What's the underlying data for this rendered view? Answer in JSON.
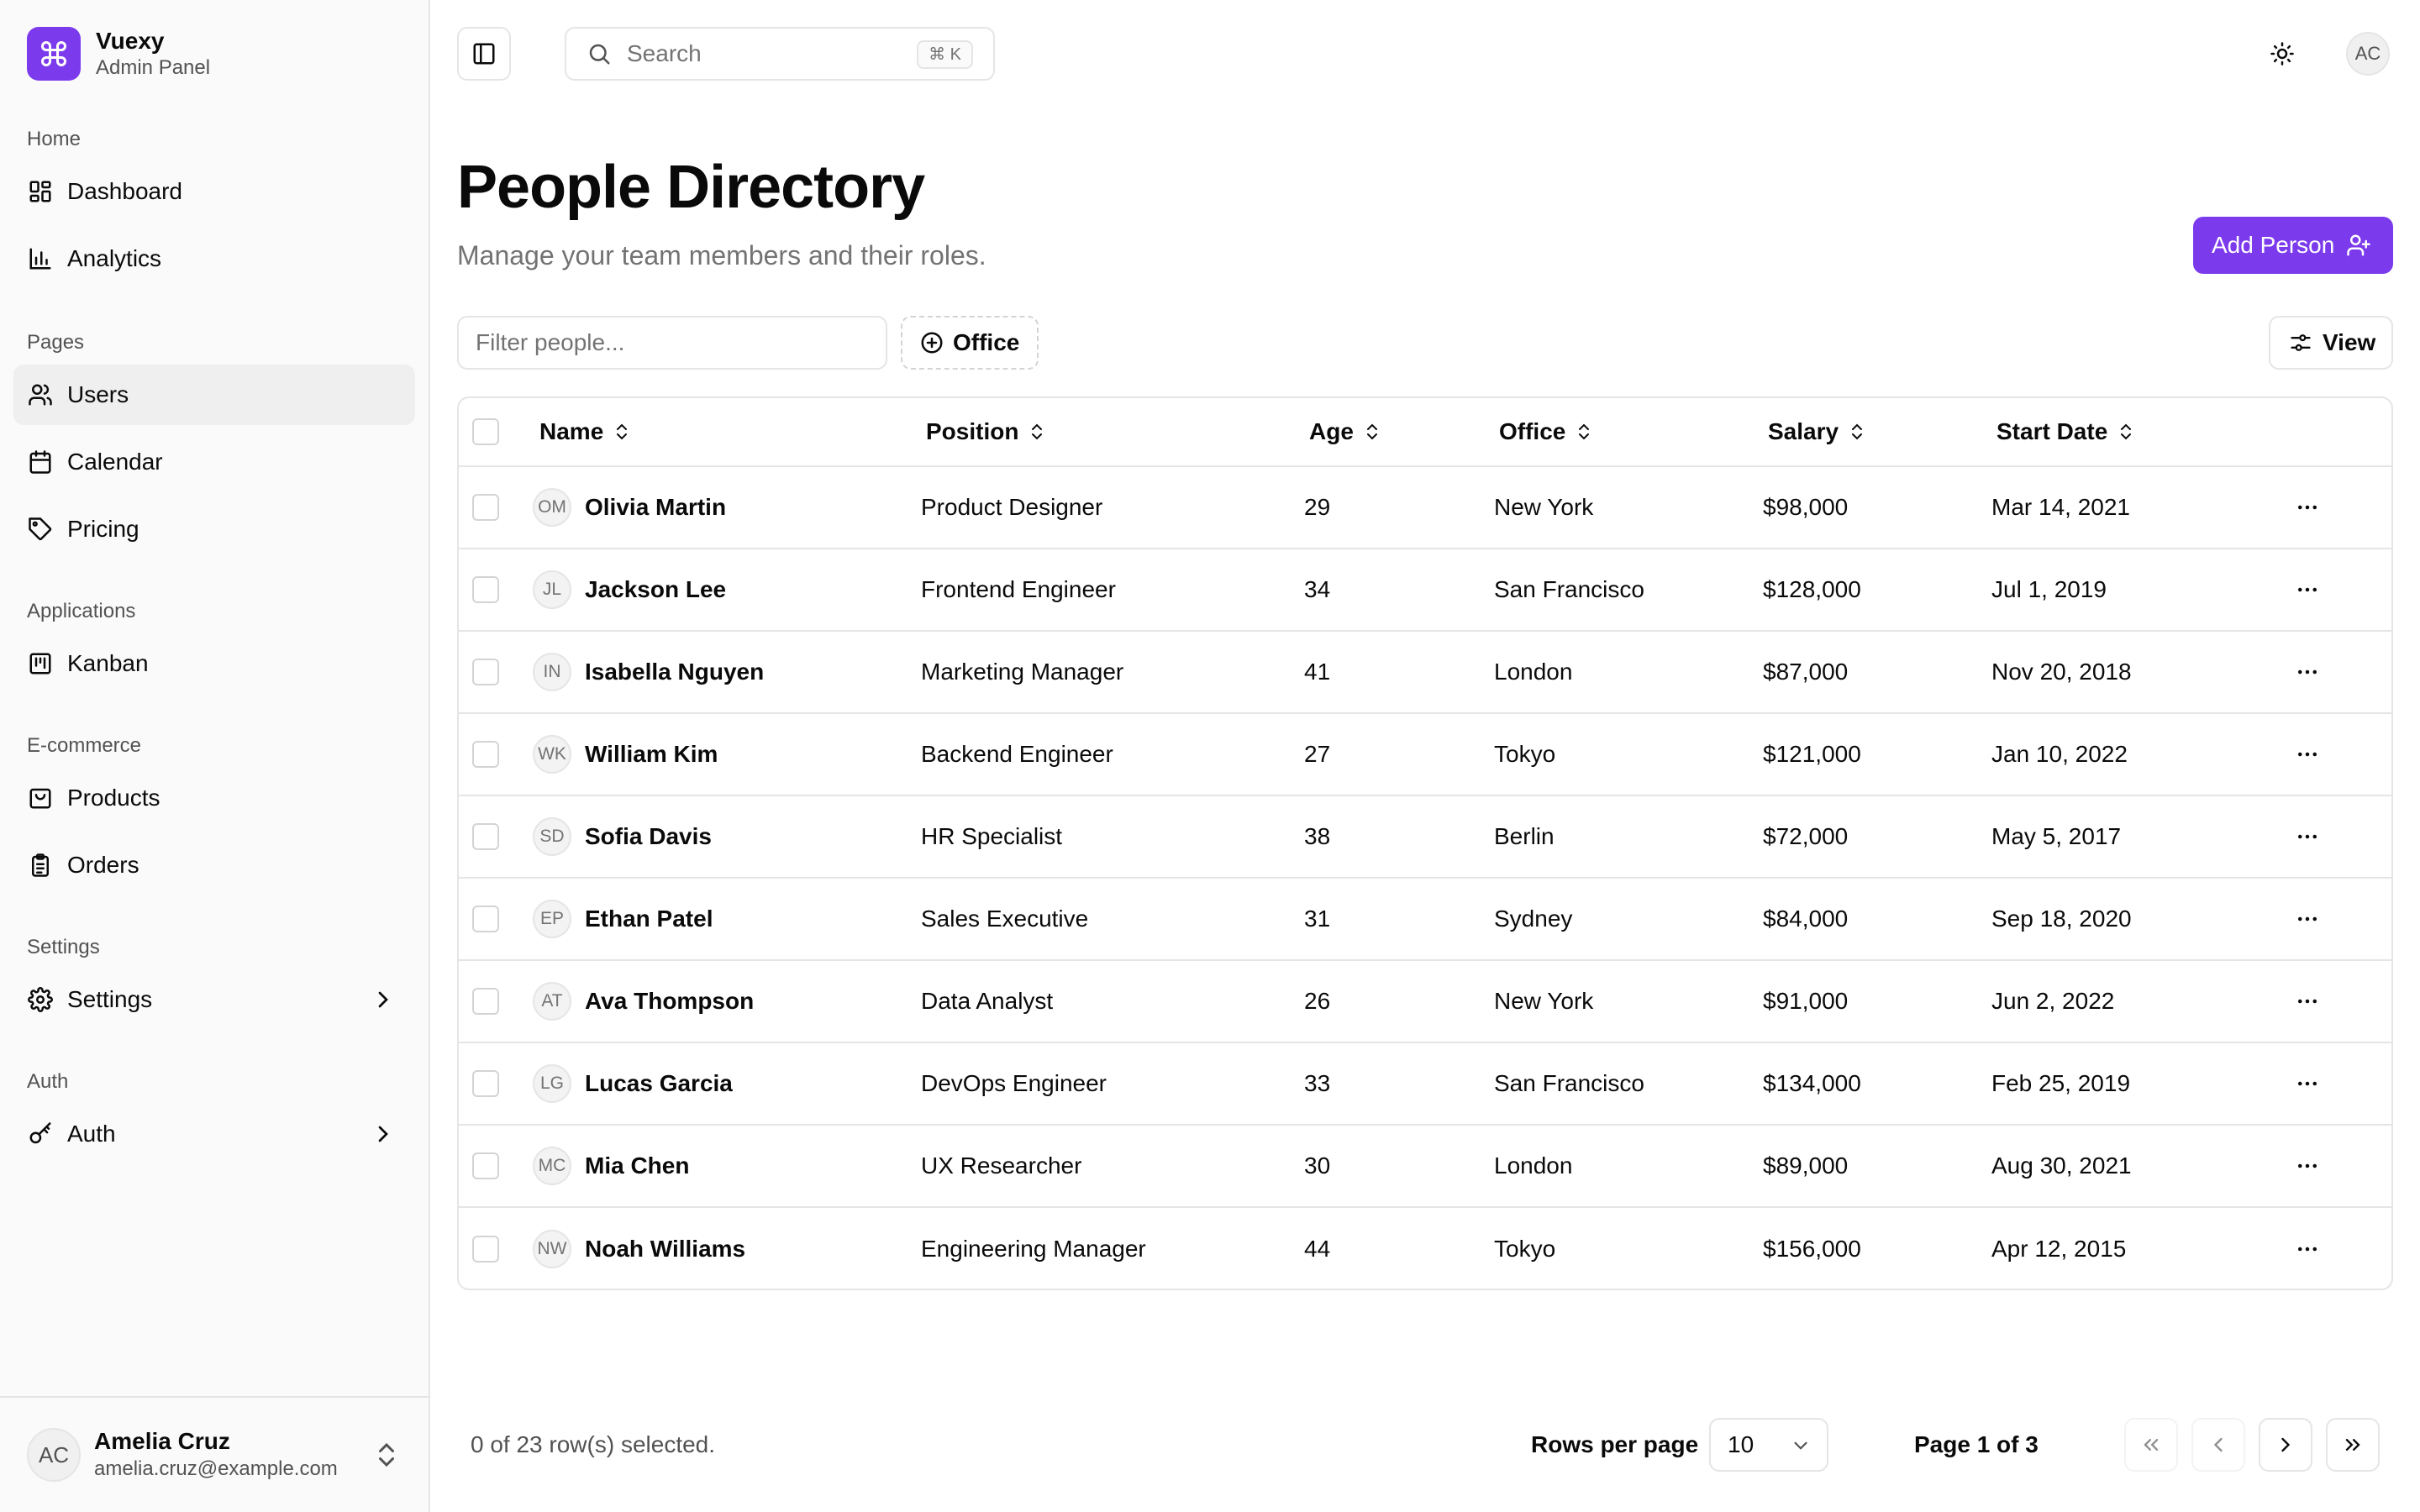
{
  "brand": {
    "name": "Vuexy",
    "subtitle": "Admin Panel"
  },
  "sidebar": {
    "groups": [
      {
        "label": "Home",
        "items": [
          {
            "label": "Dashboard",
            "icon": "dashboard-icon"
          },
          {
            "label": "Analytics",
            "icon": "bar-chart-icon"
          }
        ]
      },
      {
        "label": "Pages",
        "items": [
          {
            "label": "Users",
            "icon": "users-icon",
            "active": true
          },
          {
            "label": "Calendar",
            "icon": "calendar-icon"
          },
          {
            "label": "Pricing",
            "icon": "tag-icon"
          }
        ]
      },
      {
        "label": "Applications",
        "items": [
          {
            "label": "Kanban",
            "icon": "kanban-icon"
          }
        ]
      },
      {
        "label": "E-commerce",
        "items": [
          {
            "label": "Products",
            "icon": "shopping-bag-icon"
          },
          {
            "label": "Orders",
            "icon": "clipboard-list-icon"
          }
        ]
      },
      {
        "label": "Settings",
        "items": [
          {
            "label": "Settings",
            "icon": "gear-icon"
          }
        ]
      },
      {
        "label": "Auth",
        "items": [
          {
            "label": "Auth",
            "icon": "key-icon"
          }
        ]
      }
    ],
    "user": {
      "initials": "AC",
      "name": "Amelia Cruz",
      "email": "amelia.cruz@example.com"
    }
  },
  "topbar": {
    "search_placeholder": "Search",
    "search_shortcut": "⌘ K",
    "avatar_initials": "AC"
  },
  "header": {
    "title": "People Directory",
    "subtitle": "Manage your team members and their roles.",
    "add_button": "Add Person"
  },
  "toolbar": {
    "filter_placeholder": "Filter people...",
    "office_filter": "Office",
    "view_button": "View"
  },
  "table": {
    "columns": [
      "Name",
      "Position",
      "Age",
      "Office",
      "Salary",
      "Start Date"
    ],
    "rows": [
      {
        "initials": "OM",
        "name": "Olivia Martin",
        "position": "Product Designer",
        "age": "29",
        "office": "New York",
        "salary": "$98,000",
        "start": "Mar 14, 2021"
      },
      {
        "initials": "JL",
        "name": "Jackson Lee",
        "position": "Frontend Engineer",
        "age": "34",
        "office": "San Francisco",
        "salary": "$128,000",
        "start": "Jul 1, 2019"
      },
      {
        "initials": "IN",
        "name": "Isabella Nguyen",
        "position": "Marketing Manager",
        "age": "41",
        "office": "London",
        "salary": "$87,000",
        "start": "Nov 20, 2018"
      },
      {
        "initials": "WK",
        "name": "William Kim",
        "position": "Backend Engineer",
        "age": "27",
        "office": "Tokyo",
        "salary": "$121,000",
        "start": "Jan 10, 2022"
      },
      {
        "initials": "SD",
        "name": "Sofia Davis",
        "position": "HR Specialist",
        "age": "38",
        "office": "Berlin",
        "salary": "$72,000",
        "start": "May 5, 2017"
      },
      {
        "initials": "EP",
        "name": "Ethan Patel",
        "position": "Sales Executive",
        "age": "31",
        "office": "Sydney",
        "salary": "$84,000",
        "start": "Sep 18, 2020"
      },
      {
        "initials": "AT",
        "name": "Ava Thompson",
        "position": "Data Analyst",
        "age": "26",
        "office": "New York",
        "salary": "$91,000",
        "start": "Jun 2, 2022"
      },
      {
        "initials": "LG",
        "name": "Lucas Garcia",
        "position": "DevOps Engineer",
        "age": "33",
        "office": "San Francisco",
        "salary": "$134,000",
        "start": "Feb 25, 2019"
      },
      {
        "initials": "MC",
        "name": "Mia Chen",
        "position": "UX Researcher",
        "age": "30",
        "office": "London",
        "salary": "$89,000",
        "start": "Aug 30, 2021"
      },
      {
        "initials": "NW",
        "name": "Noah Williams",
        "position": "Engineering Manager",
        "age": "44",
        "office": "Tokyo",
        "salary": "$156,000",
        "start": "Apr 12, 2015"
      }
    ]
  },
  "footer": {
    "selection": "0 of 23 row(s) selected.",
    "rows_per_page_label": "Rows per page",
    "rows_per_page": "10",
    "page_label": "Page 1 of 3"
  },
  "colors": {
    "accent": "#7c3aed",
    "border": "#e5e5e5",
    "muted_text": "#737373",
    "active_bg": "#efefef"
  }
}
